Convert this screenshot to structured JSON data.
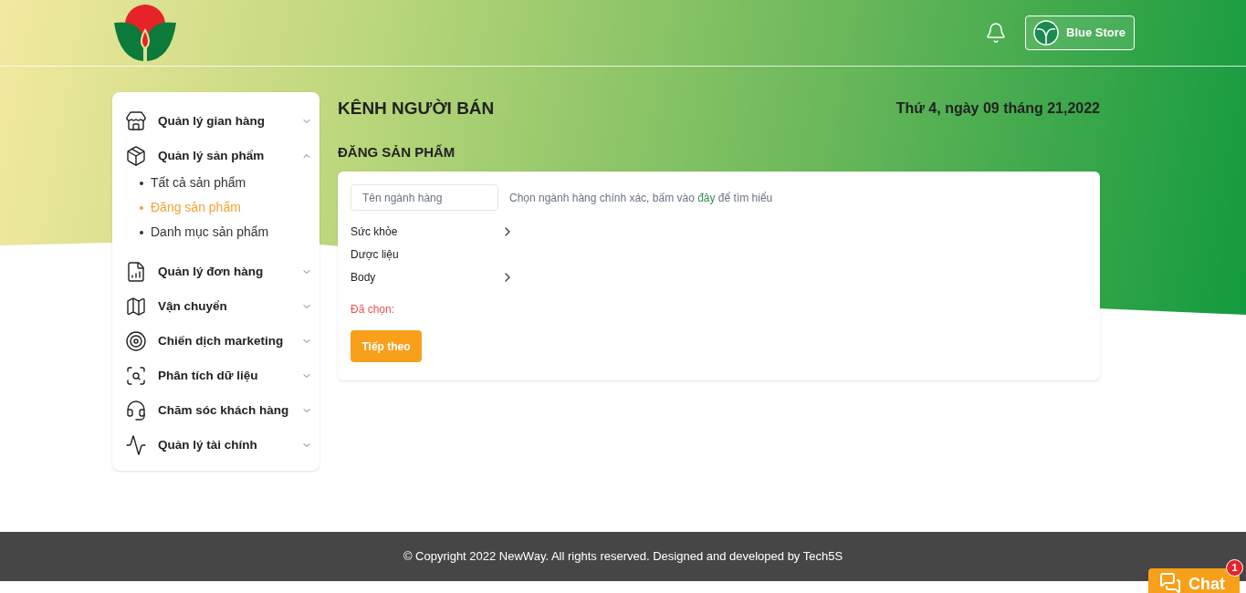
{
  "header": {
    "store_name": "Blue Store"
  },
  "sidebar": {
    "items": [
      {
        "label": "Quản lý gian hàng",
        "expanded": false
      },
      {
        "label": "Quản lý sản phẩm",
        "expanded": true,
        "children": [
          {
            "label": "Tất cả sản phẩm",
            "selected": false
          },
          {
            "label": "Đăng sản phẩm",
            "selected": true
          },
          {
            "label": "Danh mục sản phẩm",
            "selected": false
          }
        ]
      },
      {
        "label": "Quản lý đơn hàng",
        "expanded": false
      },
      {
        "label": "Vận chuyển",
        "expanded": false
      },
      {
        "label": "Chiến dịch marketing",
        "expanded": false
      },
      {
        "label": "Phân tích dữ liệu",
        "expanded": false
      },
      {
        "label": "Chăm sóc khách hàng",
        "expanded": false
      },
      {
        "label": "Quản lý tài chính",
        "expanded": false
      }
    ]
  },
  "page": {
    "title": "KÊNH NGƯỜI BÁN",
    "date": "Thứ 4, ngày 09 tháng 21,2022",
    "section_title": "ĐĂNG SẢN PHẨM"
  },
  "form": {
    "search": {
      "placeholder": "Tên ngành hàng"
    },
    "hint_before": "Chọn ngành hàng chính xác, bấm vào",
    "hint_link": "đây",
    "hint_after": "để tìm hiểu",
    "categories": [
      {
        "label": "Sức khỏe",
        "has_children": true
      },
      {
        "label": "Dược liệu",
        "has_children": false
      },
      {
        "label": "Body",
        "has_children": true
      }
    ],
    "selected_label": "Đã chọn:",
    "next_button": "Tiếp theo"
  },
  "footer": {
    "text": "© Copyright 2022 NewWay. All rights reserved. Designed and developed by Tech5S"
  },
  "chat": {
    "label": "Chat",
    "badge": "1"
  }
}
